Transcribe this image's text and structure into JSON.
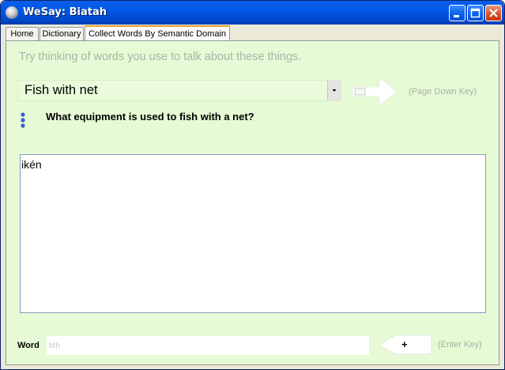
{
  "window": {
    "title": "WeSay: Biatah"
  },
  "tabs": [
    {
      "label": "Home"
    },
    {
      "label": "Dictionary"
    },
    {
      "label": "Collect Words By Semantic Domain",
      "active": true
    }
  ],
  "collect": {
    "hint": "Try thinking of words you use to talk about these things.",
    "domain_selected": "Fish with net",
    "next_key_hint": "(Page Down Key)",
    "question": "What equipment is used to fish with a net?",
    "words": [
      "ikén"
    ],
    "word_label": "Word",
    "word_value": "",
    "word_placeholder": "bth",
    "add_label": "+",
    "enter_key_hint": "(Enter Key)"
  },
  "colors": {
    "panel_bg": "#e6fad5",
    "titlebar": "#0058e6",
    "active_tab_accent": "#f0a030"
  }
}
